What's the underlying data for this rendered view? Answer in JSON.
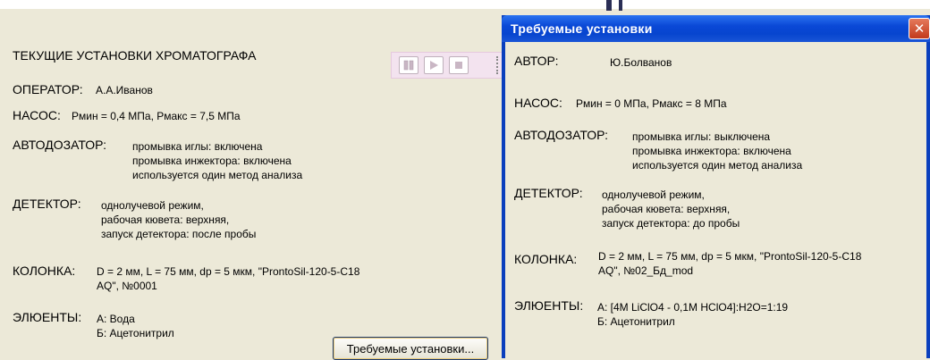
{
  "main": {
    "title": "ТЕКУЩИЕ УСТАНОВКИ ХРОМАТОГРАФА",
    "operator_label": "ОПЕРАТОР:",
    "operator_value": "А.А.Иванов",
    "pump_label": "НАСОС:",
    "pump_value": "Pмин = 0,4 МПа, Pмакс = 7,5 МПа",
    "autosampler_label": "АВТОДОЗАТОР:",
    "autosampler_lines": [
      "промывка иглы: включена",
      "промывка инжектора: включена",
      "используется один метод анализа"
    ],
    "detector_label": "ДЕТЕКТОР:",
    "detector_lines": [
      "однолучевой режим,",
      "рабочая кювета: верхняя,",
      "запуск детектора: после пробы"
    ],
    "column_label": "КОЛОНКА:",
    "column_lines": [
      "D = 2 мм, L = 75 мм, dp = 5 мкм, \"ProntoSil-120-5-C18",
      "AQ\", №0001"
    ],
    "eluents_label": "ЭЛЮЕНТЫ:",
    "eluents_lines": [
      "А: Вода",
      "Б: Ацетонитрил"
    ],
    "required_button": "Требуемые установки..."
  },
  "dialog": {
    "title": "Требуемые установки",
    "close_glyph": "✕",
    "author_label": "АВТОР:",
    "author_value": "Ю.Болванов",
    "pump_label": "НАСОС:",
    "pump_value": "Pмин = 0 МПа, Pмакс = 8 МПа",
    "autosampler_label": "АВТОДОЗАТОР:",
    "autosampler_lines": [
      "промывка иглы: выключена",
      "промывка инжектора: включена",
      "используется один метод анализа"
    ],
    "detector_label": "ДЕТЕКТОР:",
    "detector_lines": [
      "однолучевой режим,",
      "рабочая кювета: верхняя,",
      "запуск детектора: до пробы"
    ],
    "column_label": "КОЛОНКА:",
    "column_lines": [
      "D = 2 мм, L = 75 мм, dp = 5 мкм, \"ProntoSil-120-5-C18",
      "AQ\", №02_Бд_mod"
    ],
    "eluents_label": "ЭЛЮЕНТЫ:",
    "eluents_lines": [
      "А: [4M LiClO4 - 0,1M HClO4]:H2O=1:19",
      "Б: Ацетонитрил"
    ]
  },
  "media": {
    "buttons": [
      "pause-icon",
      "play-icon",
      "stop-icon"
    ],
    "color_icons": "#c9b6c4"
  },
  "colors": {
    "window_bg": "#ece9d8",
    "titlebar": "#0a48d6",
    "close": "#c23a1c"
  }
}
